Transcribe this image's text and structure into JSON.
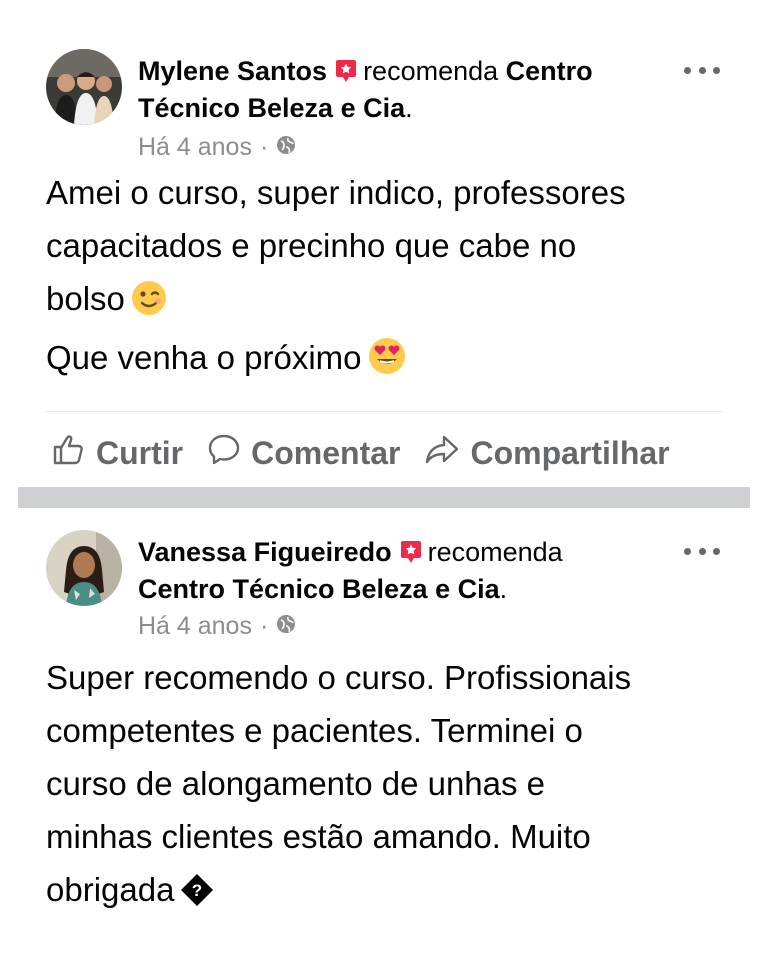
{
  "posts": [
    {
      "author": "Mylene Santos",
      "verb": "recomenda",
      "page_name": "Centro Técnico Beleza e Cia",
      "page_suffix": ".",
      "time": "Há 4 anos",
      "meta_separator": "·",
      "body_lines": [
        "Amei o curso, super indico, professores",
        "capacitados e precinho que cabe no",
        "bolso",
        "Que venha o próximo"
      ],
      "emojis": [
        "winking-face",
        "heart-eyes-face"
      ]
    },
    {
      "author": "Vanessa Figueiredo",
      "verb": "recomenda",
      "page_name": "Centro Técnico Beleza e Cia",
      "page_suffix": ".",
      "time": "Há 4 anos",
      "meta_separator": "·",
      "body_lines": [
        "Super recomendo o curso. Profissionais",
        "competentes e pacientes. Terminei o",
        "curso de alongamento de unhas e",
        "minhas clientes estão amando. Muito",
        "obrigada"
      ],
      "emojis": [
        "unknown-glyph"
      ]
    }
  ],
  "actions": {
    "like": "Curtir",
    "comment": "Comentar",
    "share": "Compartilhar"
  },
  "colors": {
    "text": "#050505",
    "secondary": "#65676b",
    "meta": "#8a8d91",
    "recommend_badge": "#f02849",
    "separator": "#ced0d4"
  }
}
